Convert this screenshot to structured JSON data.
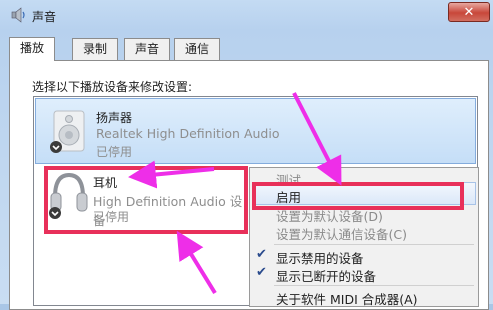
{
  "window": {
    "title": "声音",
    "close_glyph": "✕"
  },
  "tabs": [
    {
      "label": "播放",
      "active": true
    },
    {
      "label": "录制",
      "active": false
    },
    {
      "label": "声音",
      "active": false
    },
    {
      "label": "通信",
      "active": false
    }
  ],
  "instruction": "选择以下播放设备来修改设置:",
  "devices": [
    {
      "name": "扬声器",
      "driver": "Realtek High Definition Audio",
      "state": "已停用",
      "icon": "speaker-icon"
    },
    {
      "name": "耳机",
      "driver": "High Definition Audio 设备",
      "state": "已停用",
      "icon": "headphones-icon"
    }
  ],
  "context_menu": {
    "items": [
      {
        "label": "测试",
        "disabled": true
      },
      {
        "label": "启用",
        "disabled": false,
        "highlighted": true
      },
      {
        "label": "设置为默认设备(D)",
        "disabled": true
      },
      {
        "label": "设置为默认通信设备(C)",
        "disabled": true
      },
      {
        "label": "显示禁用的设备",
        "checked": true
      },
      {
        "label": "显示已断开的设备",
        "checked": true
      },
      {
        "label": "关于软件 MIDI 合成器(A)",
        "disabled": false
      }
    ]
  },
  "annotation_color": "#e8305a",
  "arrow_color": "#ee2ee8"
}
